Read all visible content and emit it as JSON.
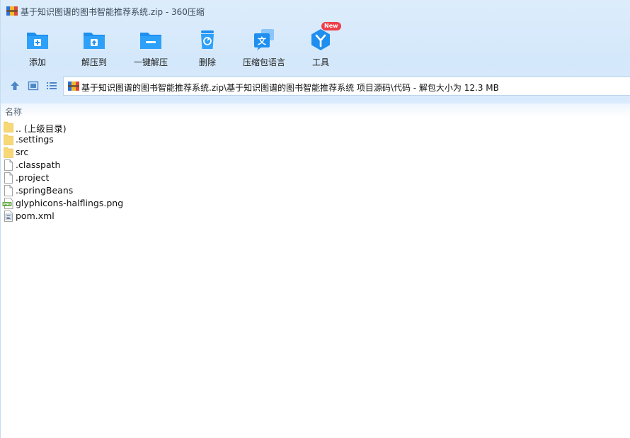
{
  "window": {
    "title": "基于知识图谱的图书智能推荐系统.zip - 360压缩"
  },
  "toolbar": {
    "buttons": [
      {
        "label": "添加",
        "icon": "add-folder-icon"
      },
      {
        "label": "解压到",
        "icon": "extract-to-icon"
      },
      {
        "label": "一键解压",
        "icon": "one-click-extract-icon"
      },
      {
        "label": "删除",
        "icon": "trash-icon"
      },
      {
        "label": "压缩包语言",
        "icon": "language-icon"
      },
      {
        "label": "工具",
        "icon": "tools-icon"
      }
    ],
    "new_badge": "New"
  },
  "nav": {
    "up_icon": "up-arrow-icon",
    "thumbnail_icon": "thumbnail-view-icon",
    "list_icon": "list-view-icon",
    "path": "基于知识图谱的图书智能推荐系统.zip\\基于知识图谱的图书智能推荐系统 项目源码\\代码 - 解包大小为 12.3 MB"
  },
  "list": {
    "column_name": "名称",
    "items": [
      {
        "name": ".. (上级目录)",
        "icon": "folder-icon"
      },
      {
        "name": ".settings",
        "icon": "folder-icon"
      },
      {
        "name": "src",
        "icon": "folder-icon"
      },
      {
        "name": ".classpath",
        "icon": "file-icon"
      },
      {
        "name": ".project",
        "icon": "file-icon"
      },
      {
        "name": ".springBeans",
        "icon": "file-icon"
      },
      {
        "name": "glyphicons-halflings.png",
        "icon": "png-file-icon"
      },
      {
        "name": "pom.xml",
        "icon": "xml-file-icon"
      }
    ]
  },
  "colors": {
    "accent": "#1e8ff0",
    "header_bg": "#d8eafc",
    "folder": "#f8d775",
    "badge": "#ef3e4a"
  }
}
